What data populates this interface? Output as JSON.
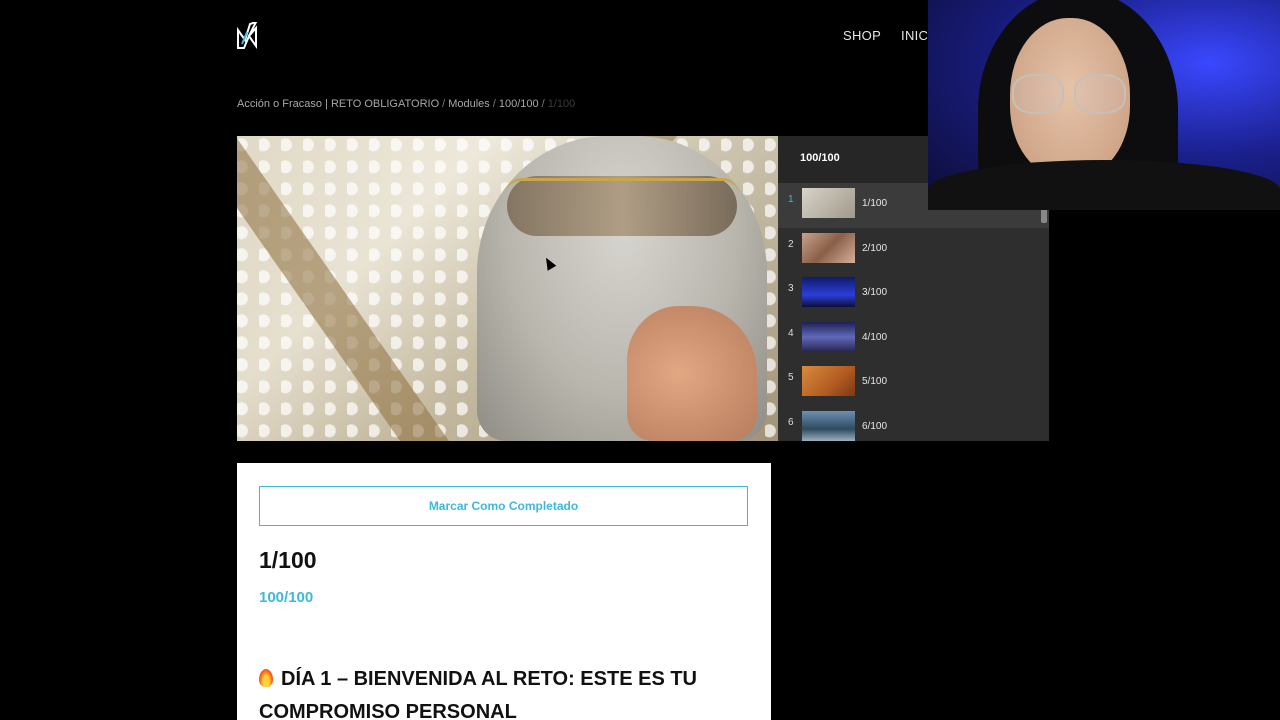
{
  "header": {
    "logo_icon": "lightning-n-logo",
    "nav": [
      "SHOP",
      "INICIO"
    ]
  },
  "breadcrumb": {
    "items": [
      "Acción o Fracaso | RETO OBLIGATORIO",
      "Modules",
      "100/100"
    ],
    "separator": "/",
    "current": "1/100"
  },
  "playlist": {
    "title": "100/100",
    "items": [
      {
        "num": "1",
        "label": "1/100"
      },
      {
        "num": "2",
        "label": "2/100"
      },
      {
        "num": "3",
        "label": "3/100"
      },
      {
        "num": "4",
        "label": "4/100"
      },
      {
        "num": "5",
        "label": "5/100"
      },
      {
        "num": "6",
        "label": "6/100"
      }
    ]
  },
  "content": {
    "complete_button": "Marcar Como Completado",
    "lesson_title": "1/100",
    "module_name": "100/100",
    "day_heading": "DÍA 1 – BIENVENIDA AL RETO: ESTE ES TU COMPROMISO PERSONAL",
    "heading_icon": "fire-icon"
  },
  "colors": {
    "accent": "#3fb8dd",
    "background": "#000000",
    "playlist_bg": "#2e2e2e"
  }
}
